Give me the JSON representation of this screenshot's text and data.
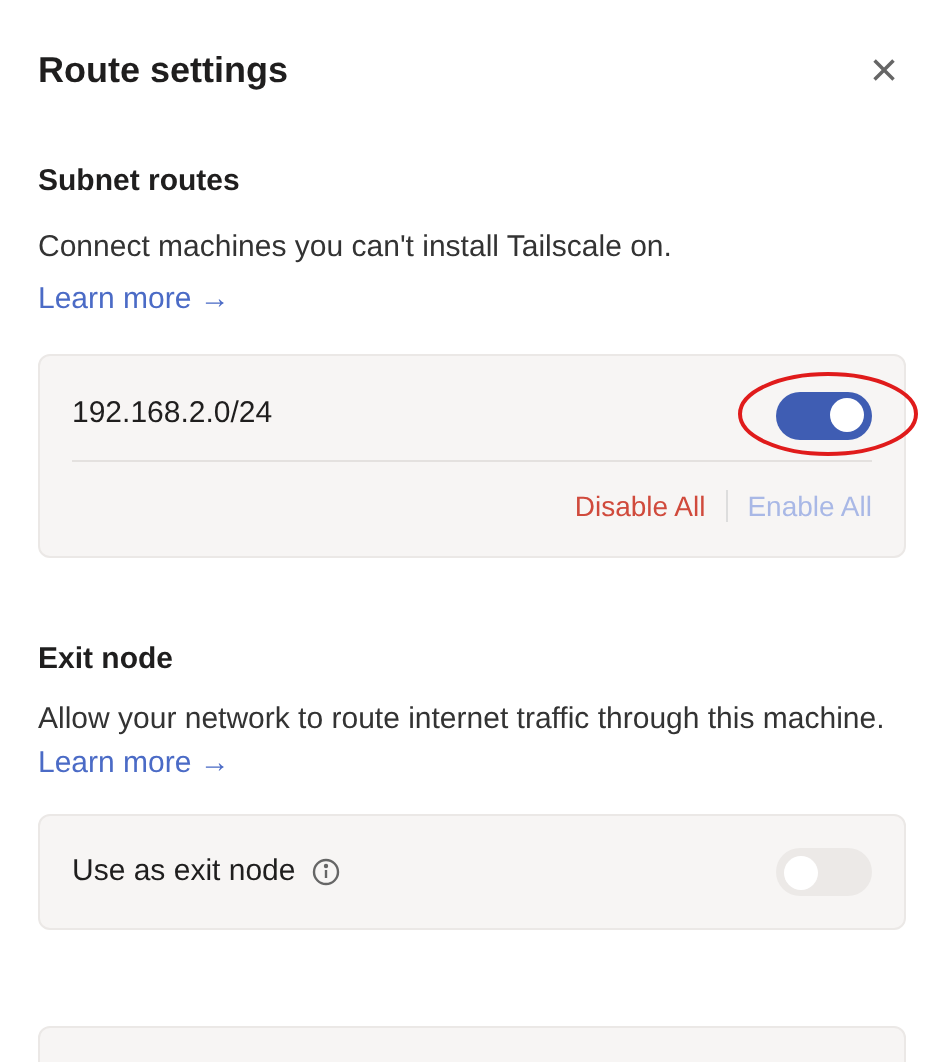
{
  "dialog": {
    "title": "Route settings",
    "close_label": "×"
  },
  "subnet_routes": {
    "heading": "Subnet routes",
    "description": "Connect machines you can't install Tailscale on.",
    "link": "Learn more →",
    "routes": [
      {
        "address": "192.168.2.0/24",
        "on": true,
        "highlighted": true
      }
    ],
    "actions": [
      {
        "label": "Disable All",
        "kind": "danger",
        "disabled": false
      },
      {
        "label": "Enable All",
        "kind": "primary",
        "disabled": true
      }
    ]
  },
  "exit_node": {
    "heading": "Exit node",
    "description": "Allow your network to route internet traffic through this machine.",
    "link": "Learn more →",
    "option": {
      "label": "Use as exit node",
      "on": false,
      "disabled": true
    }
  }
}
